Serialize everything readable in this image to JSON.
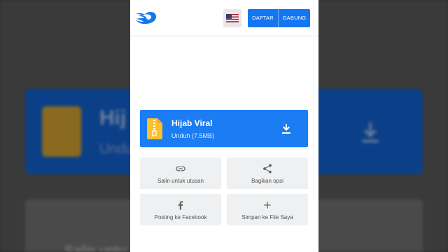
{
  "background": {
    "title": "Hij",
    "subtitle": "Unduh (",
    "bottom_text": "Salin untu"
  },
  "header": {
    "flag_icon": "us-flag-icon",
    "daftar_label": "DAFTAR",
    "gabung_label": "GABUNG"
  },
  "file": {
    "name": "Hijab Viral",
    "download_label": "Unduh (7.5MB)"
  },
  "actions": {
    "copy_link": "Salin untuk utusan",
    "share": "Bagikan opsi",
    "facebook": "Posting ke Facebook",
    "save": "Simpan ke File Saya"
  },
  "colors": {
    "accent": "#1477f1",
    "card": "#1c7cf3"
  }
}
